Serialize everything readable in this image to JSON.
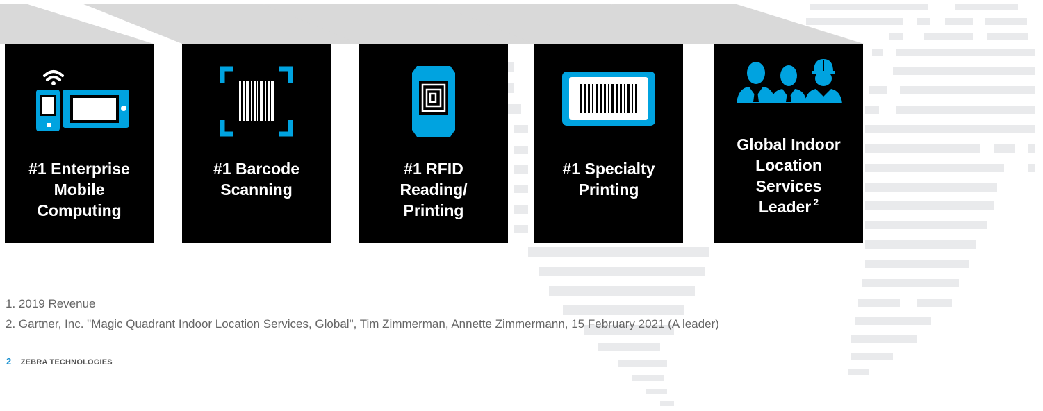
{
  "colors": {
    "accent": "#00a3e0",
    "page_number": "#1890d0",
    "card_background": "#000000",
    "globe_stripes": "#e9eaec",
    "ribbon": "#d9d9d9"
  },
  "cards": [
    {
      "icon": "mobile-computers-icon",
      "lines": [
        "#1 Enterprise",
        "Mobile",
        "Computing"
      ],
      "sup": ""
    },
    {
      "icon": "barcode-scan-icon",
      "lines": [
        "#1 Barcode",
        "Scanning"
      ],
      "sup": ""
    },
    {
      "icon": "rfid-tag-icon",
      "lines": [
        "#1 RFID",
        "Reading/",
        "Printing"
      ],
      "sup": ""
    },
    {
      "icon": "barcode-label-icon",
      "lines": [
        "#1 Specialty",
        "Printing"
      ],
      "sup": ""
    },
    {
      "icon": "workers-icon",
      "lines": [
        "Global Indoor",
        "Location",
        "Services",
        "Leader"
      ],
      "sup": "2"
    }
  ],
  "footnotes": [
    "1.  2019 Revenue",
    "2.  Gartner, Inc. \"Magic Quadrant Indoor Location Services, Global\", Tim Zimmerman, Annette Zimmermann, 15 February 2021 (A leader)"
  ],
  "footer": {
    "page_number": "2",
    "brand": "ZEBRA TECHNOLOGIES"
  }
}
